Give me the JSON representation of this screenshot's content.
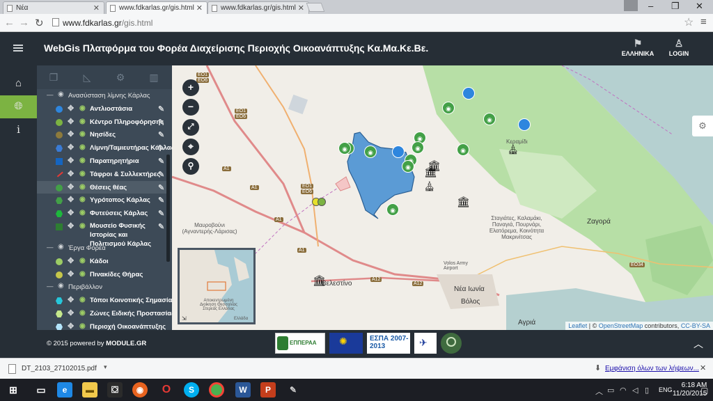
{
  "browser": {
    "tabs": [
      {
        "label": "Νέα",
        "active": false
      },
      {
        "label": "www.fdkarlas.gr/gis.html",
        "active": true
      },
      {
        "label": "www.fdkarlas.gr/gis.html",
        "active": false
      }
    ],
    "url_host": "www.fdkarlas.gr",
    "url_path": "/gis.html"
  },
  "header": {
    "title": "WebGis Πλατφόρμα του Φορέα Διαχείρισης Περιοχής Οικοανάπτυξης Κα.Μα.Κε.Βε.",
    "language_label": "ΕΛΛΗΝΙΚΑ",
    "login_label": "LOGIN"
  },
  "layers": {
    "group1": {
      "label": "Ανασύσταση λίμνης Κάρλας",
      "items": [
        {
          "label": "Αντλιοστάσια",
          "color": "#2e86de",
          "shape": "pin"
        },
        {
          "label": "Κέντρο Πληροφόρησης",
          "color": "#7cb342",
          "shape": "pin"
        },
        {
          "label": "Νησίδες",
          "color": "#8d7a3c",
          "shape": "circle"
        },
        {
          "label": "Λίμνη/Ταμιευτήρας Κάρλας",
          "color": "#3a7bd5",
          "shape": "hex"
        },
        {
          "label": "Παρατηρητήρια",
          "color": "#1565c0",
          "shape": "binoc"
        },
        {
          "label": "Τάφροι & Συλλεκτήρες",
          "color": "#e53935",
          "shape": "line"
        },
        {
          "label": "Θέσεις θέας",
          "color": "#43a047",
          "shape": "eye"
        },
        {
          "label": "Υγρότοπος Κάρλας",
          "color": "#43a047",
          "shape": "hex"
        },
        {
          "label": "Φυτεύσεις Κάρλας",
          "color": "#1db83c",
          "shape": "hex"
        },
        {
          "label": "Μουσείο Φυσικής Ιστορίας και Πολιτισμού Κάρλας",
          "color": "#2e7d32",
          "shape": "square"
        }
      ]
    },
    "group2": {
      "label": "Έργα Φορέα",
      "items": [
        {
          "label": "Κάδοι",
          "color": "#9ccc65",
          "shape": "circle"
        },
        {
          "label": "Πινακίδες Θήρας",
          "color": "#c6c64a",
          "shape": "circle"
        }
      ]
    },
    "group3": {
      "label": "Περιβάλλον",
      "items": [
        {
          "label": "Τόποι Κοινοτικής Σημασίας",
          "color": "#26c6da",
          "shape": "hex"
        },
        {
          "label": "Ζώνες Ειδικής Προστασίας",
          "color": "#c5e88c",
          "shape": "hex"
        },
        {
          "label": "Περιοχή Οικοανάπτυξης",
          "color": "#b3e5fc",
          "shape": "hex"
        }
      ]
    }
  },
  "map": {
    "roads": [
      "EO1",
      "EO6",
      "EO1",
      "EO6",
      "A1",
      "A1",
      "EO1",
      "EO6",
      "A1",
      "A1",
      "A12",
      "A12",
      "EO34"
    ],
    "places": [
      "Μαυροβούνι (Αγναντερής-Λάρισας)",
      "Βελεστίνο",
      "Σταγιάτες, Καλαμάκι, Παναγιά, Πουρνάρι, Ελατόρεμα, Κοινότητα Μακρινίτσας",
      "Volos Army Airport",
      "Νέα Ιωνία",
      "Βόλος",
      "Αγριά",
      "Ζαγορά",
      "Κεραμίδι"
    ],
    "minimap_labels": [
      "Αποκεντρωμένη Διοίκηση Θεσσαλίας Στερεάς Ελλάδας",
      "Ελλάδα"
    ],
    "attribution": {
      "leaflet": "Leaflet",
      "sep": " | © ",
      "osm": "OpenStreetMap",
      "contrib": " contributors, ",
      "license": "CC-BY-SA"
    },
    "colors": {
      "lake": "#5b9bd5",
      "forest": "#a9d89a",
      "sea": "#b5d0d0",
      "marker": "#43a047"
    }
  },
  "footer": {
    "copyright_prefix": "© 2015 powered by ",
    "copyright_brand": "MODULE.GR",
    "logos": [
      "ΕΠΠΕΡΑΑ",
      "EU",
      "ΕΣΠΑ 2007-2013",
      "bird",
      "seal"
    ]
  },
  "downloads": {
    "file": "DT_2103_27102015.pdf",
    "show_all": "Εμφάνιση όλων των λήψεων..."
  },
  "taskbar": {
    "lang": "ENG",
    "time": "6:18 AM",
    "date": "11/20/2015"
  }
}
